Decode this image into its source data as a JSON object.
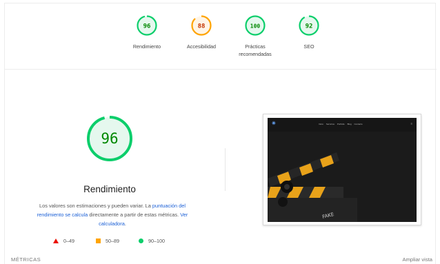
{
  "summary": {
    "gauges": [
      {
        "score": "96",
        "value": 96,
        "label": "Rendimiento",
        "status": "pass"
      },
      {
        "score": "88",
        "value": 88,
        "label": "Accesibilidad",
        "status": "average"
      },
      {
        "score": "100",
        "value": 100,
        "label_line1": "Prácticas",
        "label_line2": "recomendadas",
        "status": "pass"
      },
      {
        "score": "92",
        "value": 92,
        "label": "SEO",
        "status": "pass"
      }
    ]
  },
  "main": {
    "score": "96",
    "value": 96,
    "title": "Rendimiento",
    "desc_text1": "Los valores son estimaciones y pueden variar. La ",
    "desc_link1": "puntuación del rendimiento se calcula",
    "desc_text2": " directamente a partir de estas métricas. ",
    "desc_link2": "Ver calculadora",
    "desc_text3": "."
  },
  "legend": {
    "fail": "0–49",
    "average": "50–89",
    "pass": "90–100"
  },
  "screenshot": {
    "nav_links": "Inicio Servicios Portfolio Blog Contacto",
    "menu_icon": "menu-icon",
    "caption_text": "FAKE"
  },
  "footer": {
    "metrics_label": "MÉTRICAS",
    "expand_label": "Ampliar vista"
  },
  "colors": {
    "pass": "#0cce6b",
    "pass_text": "#008800",
    "pass_bg": "#e5f8ee",
    "average": "#ffa400",
    "average_text": "#c33300",
    "average_bg": "#fff5e6",
    "fail": "#eb0f00",
    "link": "#1a5fd6"
  }
}
